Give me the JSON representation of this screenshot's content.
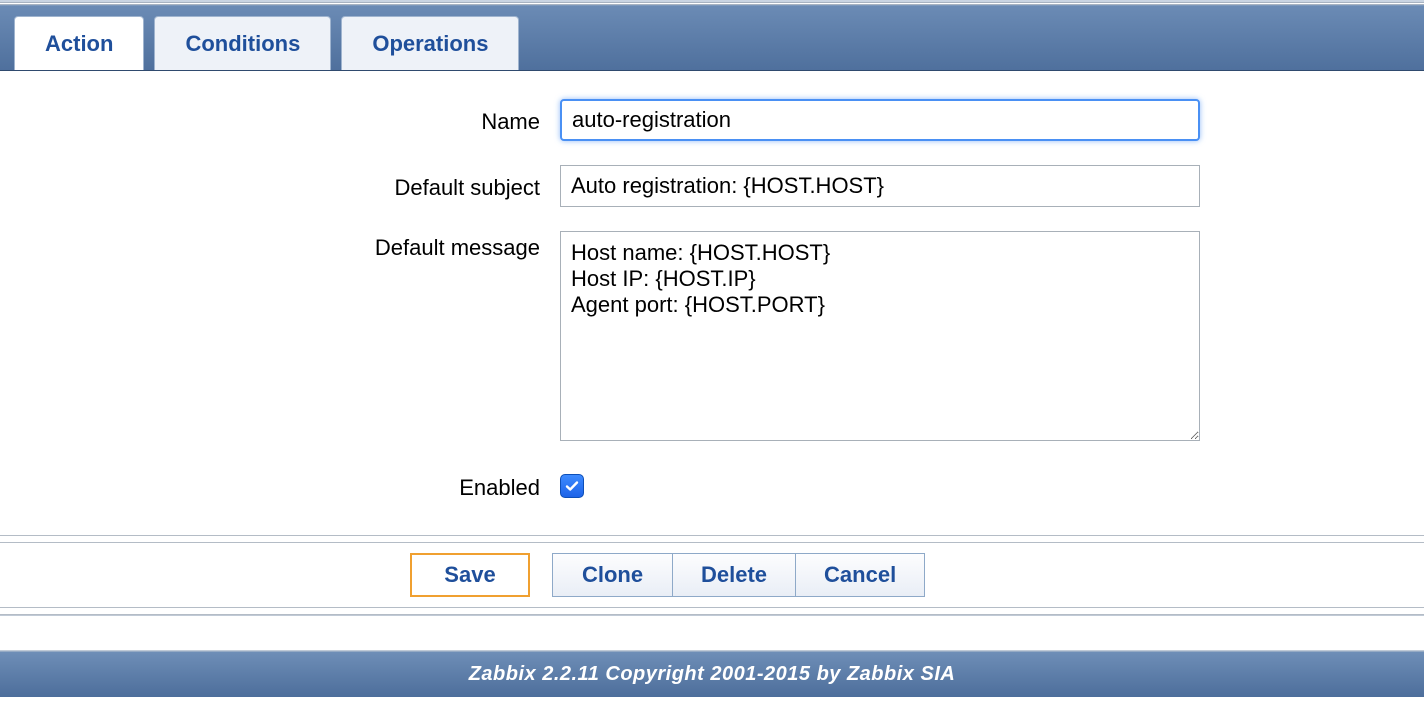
{
  "tabs": {
    "action": "Action",
    "conditions": "Conditions",
    "operations": "Operations"
  },
  "form": {
    "name_label": "Name",
    "name_value": "auto-registration",
    "subject_label": "Default subject",
    "subject_value": "Auto registration: {HOST.HOST}",
    "message_label": "Default message",
    "message_value": "Host name: {HOST.HOST}\nHost IP: {HOST.IP}\nAgent port: {HOST.PORT}",
    "enabled_label": "Enabled",
    "enabled_value": true
  },
  "buttons": {
    "save": "Save",
    "clone": "Clone",
    "delete": "Delete",
    "cancel": "Cancel"
  },
  "footer": "Zabbix 2.2.11 Copyright 2001-2015 by Zabbix SIA"
}
